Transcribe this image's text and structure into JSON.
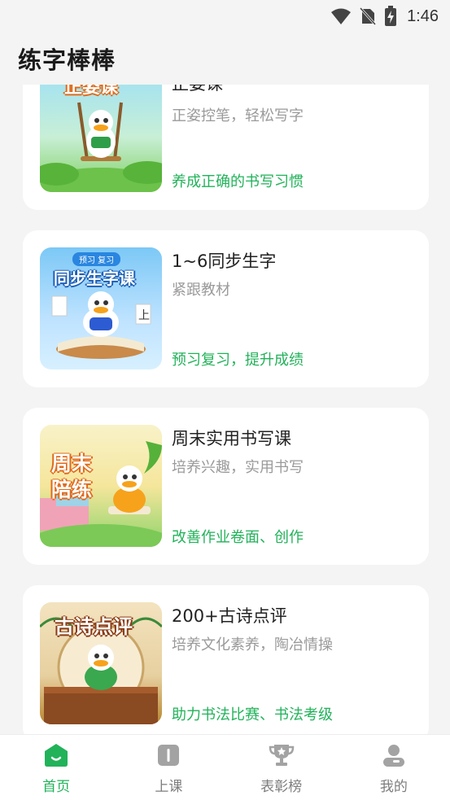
{
  "status_bar": {
    "time": "1:46",
    "icons": [
      "wifi-icon",
      "no-sim-icon",
      "battery-charging-icon"
    ]
  },
  "header": {
    "title": "练字棒棒"
  },
  "courses": [
    {
      "thumb_text": "正姿课",
      "title": "正姿课",
      "subtitle": "正姿控笔，轻松写字",
      "tagline": "养成正确的书写习惯"
    },
    {
      "thumb_badge": "预习 复习",
      "thumb_text": "同步生字课",
      "title": "1~6同步生字",
      "subtitle": "紧跟教材",
      "tagline": "预习复习，提升成绩"
    },
    {
      "thumb_text_line1": "周末",
      "thumb_text_line2": "陪练",
      "title": "周末实用书写课",
      "subtitle": "培养兴趣，实用书写",
      "tagline": "改善作业卷面、创作"
    },
    {
      "thumb_text": "古诗点评",
      "title": "200+古诗点评",
      "subtitle": "培养文化素养，陶冶情操",
      "tagline": "助力书法比赛、书法考级"
    }
  ],
  "bottom_nav": [
    {
      "label": "首页",
      "icon": "home-icon",
      "active": true
    },
    {
      "label": "上课",
      "icon": "book-icon",
      "active": false
    },
    {
      "label": "表彰榜",
      "icon": "trophy-icon",
      "active": false
    },
    {
      "label": "我的",
      "icon": "user-icon",
      "active": false
    }
  ],
  "colors": {
    "accent": "#22b25a",
    "background": "#f3f4f3",
    "card": "#ffffff",
    "muted_text": "#9a9a9a",
    "nav_inactive": "#7d7d7d"
  }
}
